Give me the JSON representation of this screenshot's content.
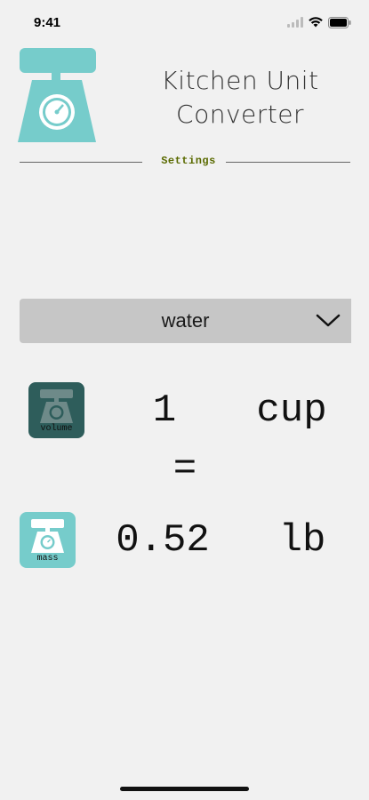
{
  "status_bar": {
    "time": "9:41",
    "icons": [
      "signal-icon",
      "wifi-icon",
      "battery-icon"
    ]
  },
  "header": {
    "title_line1": "Kitchen Unit",
    "title_line2": "Converter",
    "logo_icon": "kitchen-scale-icon"
  },
  "settings": {
    "label": "Settings"
  },
  "ingredient": {
    "selected": "water",
    "chevron_icon": "chevron-down-icon"
  },
  "conversion": {
    "from_quantity": "1",
    "from_unit": "cup",
    "equals": "=",
    "to_quantity": "0.52",
    "to_unit": "lb"
  },
  "unit_types": {
    "volume_label": "volume",
    "mass_label": "mass"
  },
  "colors": {
    "brand_teal": "#76cccb",
    "volume_dark": "#2e5d5b",
    "dropdown_bg": "#c6c6c6",
    "settings_text": "#5a6a00",
    "background": "#f1f1f1"
  }
}
